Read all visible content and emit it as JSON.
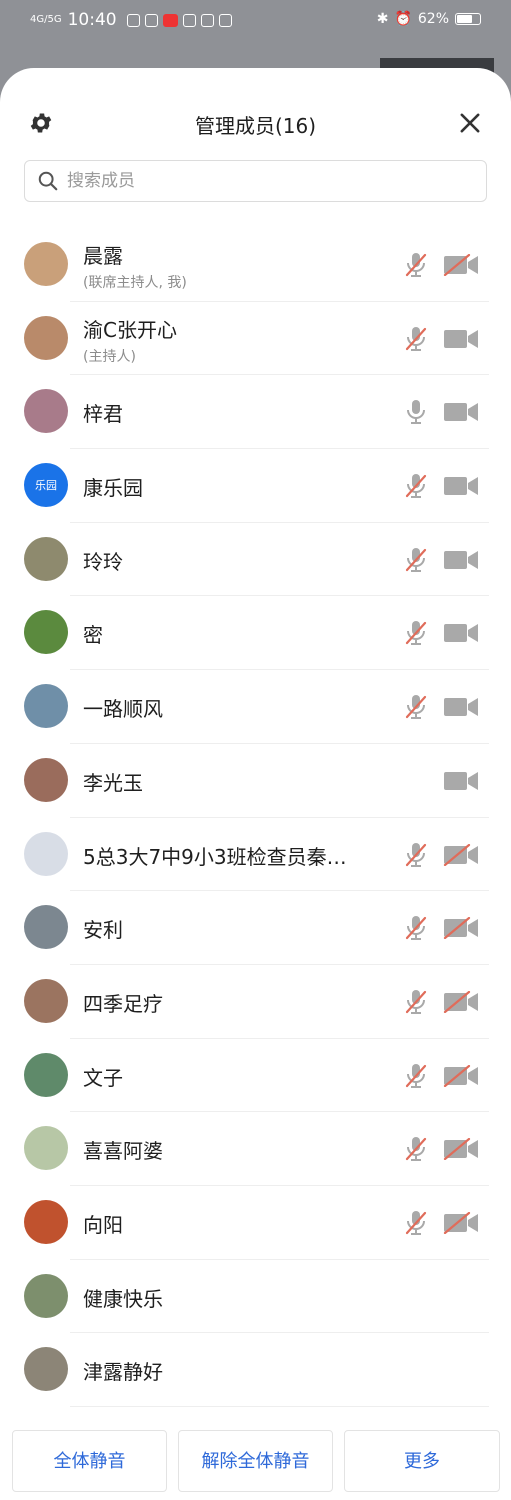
{
  "status_bar": {
    "time": "10:40",
    "signal": "4G/5G",
    "battery": "62%",
    "app_icons": [
      "app-icon",
      "app-icon",
      "red-app-icon",
      "app-icon",
      "tiktok-icon",
      "app-icon"
    ]
  },
  "header": {
    "title": "管理成员(16)",
    "settings_icon": "gear-icon",
    "close_icon": "close-icon"
  },
  "search": {
    "placeholder": "搜索成员",
    "value": ""
  },
  "members": [
    {
      "name": "晨露",
      "role": "(联席主持人, 我)",
      "avatar_color": "#c9a07a",
      "mic": "muted",
      "cam": "off"
    },
    {
      "name": "渝C张开心",
      "role": "(主持人)",
      "avatar_color": "#b98a6a",
      "mic": "muted",
      "cam": "on"
    },
    {
      "name": "梓君",
      "role": "",
      "avatar_color": "#a87b8a",
      "mic": "on",
      "cam": "on"
    },
    {
      "name": "康乐园",
      "role": "",
      "avatar_color": "#1a73e8",
      "avatar_text": "乐园",
      "mic": "muted",
      "cam": "on"
    },
    {
      "name": "玲玲",
      "role": "",
      "avatar_color": "#8e8a6e",
      "mic": "muted",
      "cam": "on"
    },
    {
      "name": "密",
      "role": "",
      "avatar_color": "#5b8a3e",
      "mic": "muted",
      "cam": "on"
    },
    {
      "name": "一路顺风",
      "role": "",
      "avatar_color": "#6f8fa8",
      "mic": "muted",
      "cam": "on"
    },
    {
      "name": "李光玉",
      "role": "",
      "avatar_color": "#9a6c5c",
      "mic": "none",
      "cam": "on"
    },
    {
      "name": "5总3大7中9小3班检查员秦…",
      "role": "",
      "avatar_color": "#d8dde6",
      "mic": "muted",
      "cam": "off"
    },
    {
      "name": "安利",
      "role": "",
      "avatar_color": "#7c8790",
      "mic": "muted",
      "cam": "off"
    },
    {
      "name": "四季足疗",
      "role": "",
      "avatar_color": "#9b7460",
      "mic": "muted",
      "cam": "off"
    },
    {
      "name": "文子",
      "role": "",
      "avatar_color": "#5f8a6a",
      "mic": "muted",
      "cam": "off"
    },
    {
      "name": "喜喜阿婆",
      "role": "",
      "avatar_color": "#b7c7a6",
      "mic": "muted",
      "cam": "off"
    },
    {
      "name": "向阳",
      "role": "",
      "avatar_color": "#c0522e",
      "mic": "muted",
      "cam": "off"
    },
    {
      "name": "健康快乐",
      "role": "",
      "avatar_color": "#7d8f6d",
      "mic": "none",
      "cam": "none"
    },
    {
      "name": "津露静好",
      "role": "",
      "avatar_color": "#8c8577",
      "mic": "none",
      "cam": "none"
    }
  ],
  "footer": {
    "mute_all": "全体静音",
    "unmute_all": "解除全体静音",
    "more": "更多"
  },
  "colors": {
    "accent": "#2e69d9",
    "icon_gray": "#a9a9a9",
    "muted_red": "#e06c5a"
  }
}
